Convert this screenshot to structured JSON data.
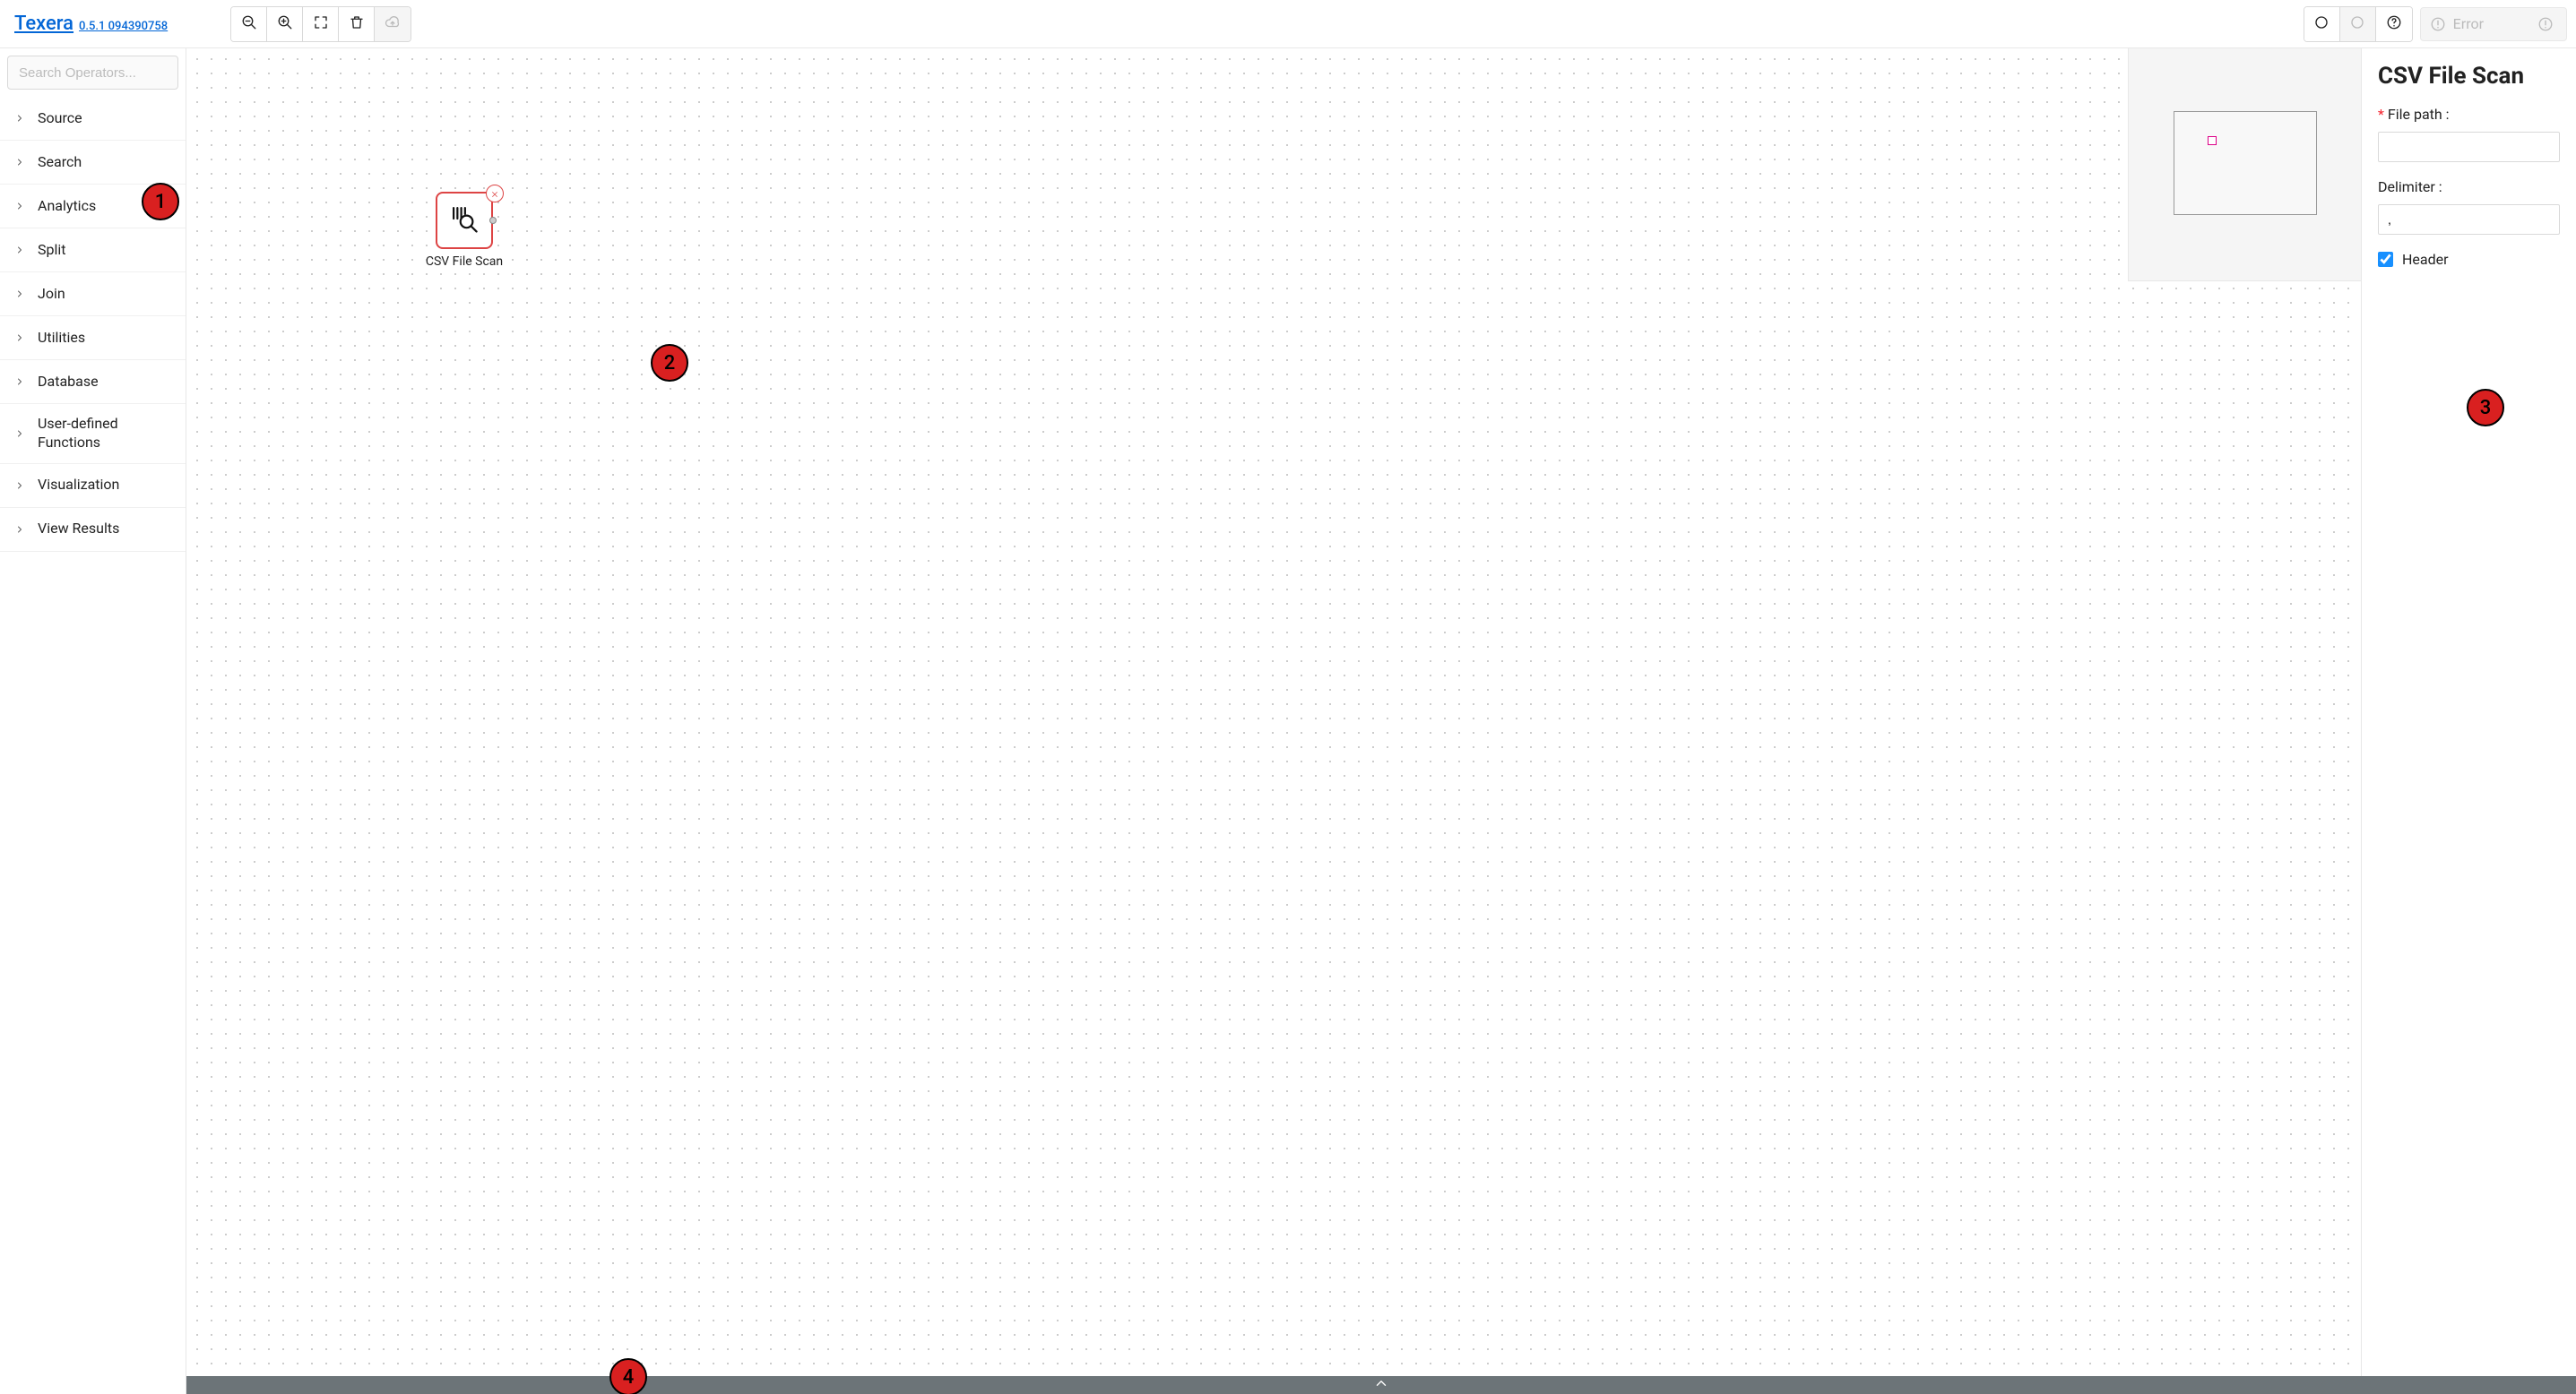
{
  "brand": {
    "name": "Texera",
    "version": "0.5.1 094390758"
  },
  "toolbar": {
    "error_label": "Error"
  },
  "sidebar": {
    "search_placeholder": "Search Operators...",
    "categories": [
      {
        "label": "Source"
      },
      {
        "label": "Search"
      },
      {
        "label": "Analytics"
      },
      {
        "label": "Split"
      },
      {
        "label": "Join"
      },
      {
        "label": "Utilities"
      },
      {
        "label": "Database"
      },
      {
        "label": "User-defined Functions"
      },
      {
        "label": "Visualization"
      },
      {
        "label": "View Results"
      }
    ]
  },
  "canvas": {
    "operator": {
      "label": "CSV File Scan"
    }
  },
  "props": {
    "title": "CSV File Scan",
    "file_path_label": "File path :",
    "file_path_value": "",
    "delimiter_label": "Delimiter :",
    "delimiter_value": ",",
    "header_label": "Header",
    "header_checked": true
  },
  "markers": {
    "m1": "1",
    "m2": "2",
    "m3": "3",
    "m4": "4"
  }
}
